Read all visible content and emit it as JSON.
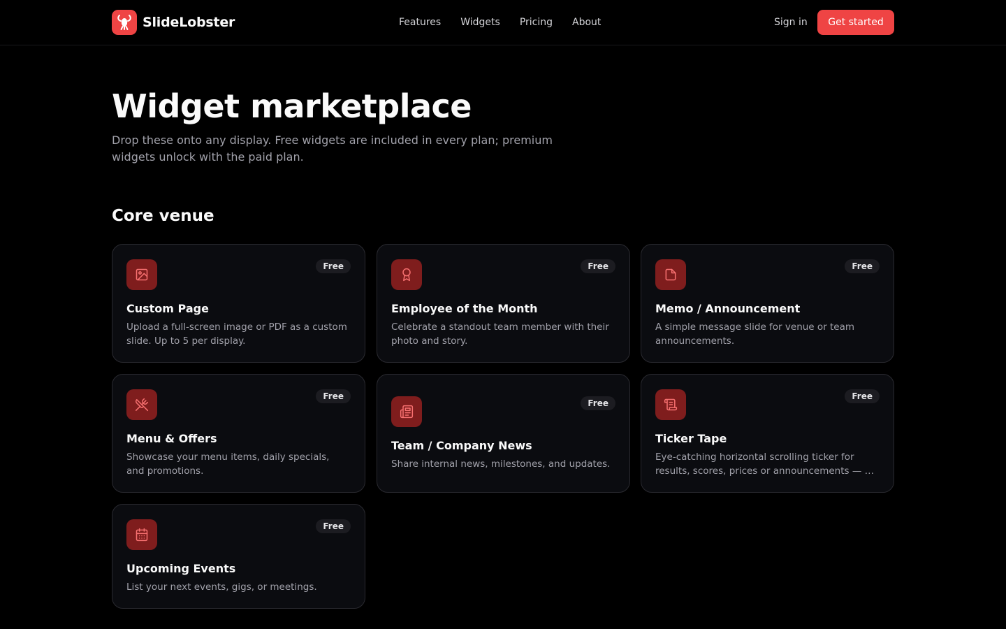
{
  "brand": {
    "name": "SlideLobster",
    "logo_icon": "lobster-icon"
  },
  "nav": {
    "items": [
      {
        "label": "Features"
      },
      {
        "label": "Widgets"
      },
      {
        "label": "Pricing"
      },
      {
        "label": "About"
      }
    ],
    "signin_label": "Sign in",
    "cta_label": "Get started"
  },
  "page": {
    "title": "Widget marketplace",
    "subtitle": "Drop these onto any display. Free widgets are included in every plan; premium widgets unlock with the paid plan."
  },
  "section": {
    "title": "Core venue",
    "cards": [
      {
        "title": "Custom Page",
        "desc": "Upload a full-screen image or PDF as a custom slide. Up to 5 per display.",
        "badge": "Free",
        "icon": "image-icon"
      },
      {
        "title": "Employee of the Month",
        "desc": "Celebrate a standout team member with their photo and story.",
        "badge": "Free",
        "icon": "award-icon"
      },
      {
        "title": "Memo / Announcement",
        "desc": "A simple message slide for venue or team announcements.",
        "badge": "Free",
        "icon": "file-icon"
      },
      {
        "title": "Menu & Offers",
        "desc": "Showcase your menu items, daily specials, and promotions.",
        "badge": "Free",
        "icon": "utensils-crossed-icon"
      },
      {
        "title": "Team / Company News",
        "desc": "Share internal news, milestones, and updates.",
        "badge": "Free",
        "icon": "newspaper-icon"
      },
      {
        "title": "Ticker Tape",
        "desc": "Eye-catching horizontal scrolling ticker for results, scores, prices or announcements — all in one continuous line.",
        "badge": "Free",
        "icon": "scroll-icon"
      },
      {
        "title": "Upcoming Events",
        "desc": "List your next events, gigs, or meetings.",
        "badge": "Free",
        "icon": "calendar-icon"
      }
    ]
  },
  "colors": {
    "accent": "#ef4444",
    "icon_bg": "#7f1d1d",
    "icon_stroke": "#f87171",
    "background": "#000000"
  }
}
